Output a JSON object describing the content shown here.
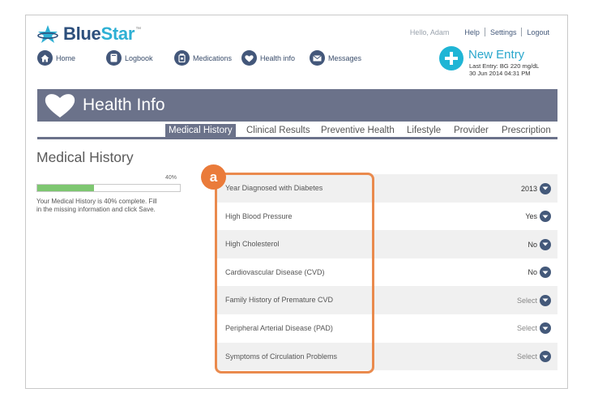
{
  "brand": {
    "name_part1": "Blue",
    "name_part2": "Star",
    "tm": "™"
  },
  "header": {
    "greeting": "Hello, Adam",
    "links": [
      "Help",
      "Settings",
      "Logout"
    ]
  },
  "nav": [
    {
      "label": "Home",
      "icon": "home-icon"
    },
    {
      "label": "Logbook",
      "icon": "logbook-icon"
    },
    {
      "label": "Medications",
      "icon": "medication-icon"
    },
    {
      "label": "Health info",
      "icon": "heart-icon"
    },
    {
      "label": "Messages",
      "icon": "envelope-icon"
    }
  ],
  "new_entry": {
    "title": "New Entry",
    "last_entry": "Last Entry: BG 220 mg/dL",
    "last_entry_time": "30 Jun 2014 04:31 PM"
  },
  "banner": {
    "title": "Health Info",
    "icon": "heart-icon"
  },
  "tabs": [
    {
      "label": "Medical History",
      "active": true
    },
    {
      "label": "Clinical Results",
      "active": false
    },
    {
      "label": "Preventive Health",
      "active": false
    },
    {
      "label": "Lifestyle",
      "active": false
    },
    {
      "label": "Provider",
      "active": false
    },
    {
      "label": "Prescription",
      "active": false
    }
  ],
  "section": {
    "title": "Medical History",
    "progress_label": "40%",
    "progress_fraction": 0.4,
    "help_text": "Your Medical History is 40% complete. Fill in the missing information and click Save."
  },
  "rows": [
    {
      "label": "Year Diagnosed with Diabetes",
      "value": "2013"
    },
    {
      "label": "High Blood Pressure",
      "value": "Yes"
    },
    {
      "label": "High Cholesterol",
      "value": "No"
    },
    {
      "label": "Cardiovascular Disease (CVD)",
      "value": "No"
    },
    {
      "label": "Family History of Premature CVD",
      "value": "Select"
    },
    {
      "label": "Peripheral Arterial Disease (PAD)",
      "value": "Select"
    },
    {
      "label": "Symptoms of Circulation Problems",
      "value": "Select"
    }
  ],
  "callout": {
    "label": "a"
  },
  "colors": {
    "banner": "#6b728a",
    "navy": "#44597a",
    "accent": "#1fb5d5",
    "progress": "#7ec771",
    "callout": "#ea7b3a"
  }
}
